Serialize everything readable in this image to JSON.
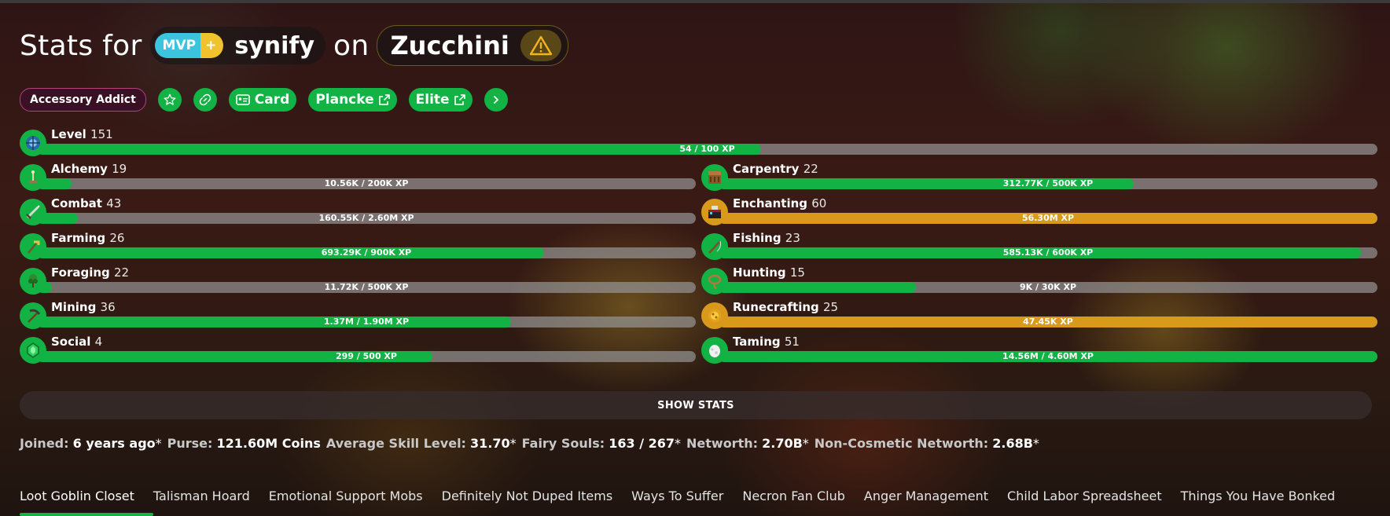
{
  "header": {
    "prefix": "Stats for",
    "rank_main": "MVP",
    "rank_plus": "+",
    "player_name": "synify",
    "connector": "on",
    "profile_name": "Zucchini",
    "warning_icon": "warning-triangle-icon"
  },
  "chips": {
    "accessory": "Accessory Addict",
    "card": "Card",
    "plancke": "Plancke",
    "elite": "Elite",
    "icons": [
      "star-icon",
      "link-icon",
      "id-card-icon",
      "external-link-icon",
      "chevron-right-icon"
    ]
  },
  "level": {
    "name": "Level",
    "level": "151",
    "xp": "54 / 100 XP",
    "progress": 0.54
  },
  "skills_left": [
    {
      "name": "Alchemy",
      "level": "19",
      "xp": "10.56K / 200K XP",
      "progress": 0.053,
      "maxed": false,
      "icon": "brewing-stand-icon"
    },
    {
      "name": "Combat",
      "level": "43",
      "xp": "160.55K / 2.60M XP",
      "progress": 0.062,
      "maxed": false,
      "icon": "sword-icon"
    },
    {
      "name": "Farming",
      "level": "26",
      "xp": "693.29K / 900K XP",
      "progress": 0.77,
      "maxed": false,
      "icon": "hoe-icon"
    },
    {
      "name": "Foraging",
      "level": "22",
      "xp": "11.72K / 500K XP",
      "progress": 0.023,
      "maxed": false,
      "icon": "sapling-icon"
    },
    {
      "name": "Mining",
      "level": "36",
      "xp": "1.37M / 1.90M XP",
      "progress": 0.72,
      "maxed": false,
      "icon": "pickaxe-icon"
    },
    {
      "name": "Social",
      "level": "4",
      "xp": "299 / 500 XP",
      "progress": 0.6,
      "maxed": false,
      "icon": "emerald-icon"
    }
  ],
  "skills_right": [
    {
      "name": "Carpentry",
      "level": "22",
      "xp": "312.77K / 500K XP",
      "progress": 0.63,
      "maxed": false,
      "icon": "crafting-table-icon"
    },
    {
      "name": "Enchanting",
      "level": "60",
      "xp": "56.30M XP",
      "progress": 1.0,
      "maxed": true,
      "icon": "enchanting-table-icon"
    },
    {
      "name": "Fishing",
      "level": "23",
      "xp": "585.13K / 600K XP",
      "progress": 0.975,
      "maxed": false,
      "icon": "fishing-rod-icon"
    },
    {
      "name": "Hunting",
      "level": "15",
      "xp": "9K / 30K XP",
      "progress": 0.3,
      "maxed": false,
      "icon": "lasso-icon"
    },
    {
      "name": "Runecrafting",
      "level": "25",
      "xp": "47.45K XP",
      "progress": 1.0,
      "maxed": true,
      "icon": "magma-cream-icon"
    },
    {
      "name": "Taming",
      "level": "51",
      "xp": "14.56M / 4.60M XP",
      "progress": 1.0,
      "maxed": false,
      "icon": "spawn-egg-icon"
    }
  ],
  "colors": {
    "accent": "#12b344",
    "maxed": "#d99a1c",
    "track": "#969696"
  },
  "show_stats_label": "SHOW STATS",
  "summary": {
    "joined_label": "Joined:",
    "joined_value": "6 years ago",
    "purse_label": "Purse:",
    "purse_value": "121.60M Coins",
    "skill_avg_label": "Average Skill Level:",
    "skill_avg_value": "31.70",
    "fairy_label": "Fairy Souls:",
    "fairy_value": "163 / 267",
    "networth_label": "Networth:",
    "networth_value": "2.70B",
    "noncos_label": "Non-Cosmetic Networth:",
    "noncos_value": "2.68B",
    "star": "*"
  },
  "tabs": [
    "Loot Goblin Closet",
    "Talisman Hoard",
    "Emotional Support Mobs",
    "Definitely Not Duped Items",
    "Ways To Suffer",
    "Necron Fan Club",
    "Anger Management",
    "Child Labor Spreadsheet",
    "Things You Have Bonked"
  ]
}
